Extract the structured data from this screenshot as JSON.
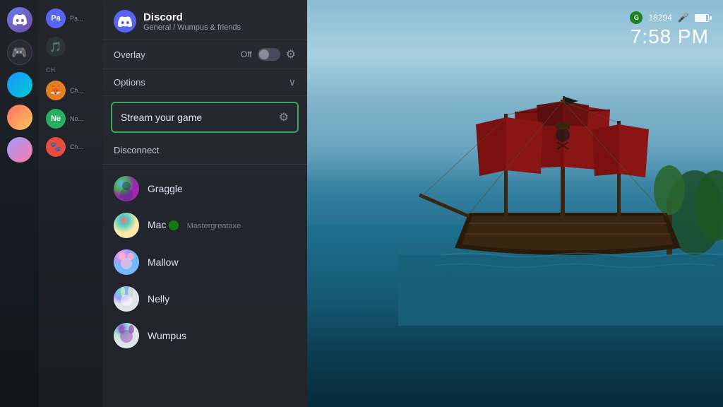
{
  "background": {
    "description": "Sea of Thieves pirate ship scene"
  },
  "hud": {
    "xbox_score": "18294",
    "time": "7:58 PM"
  },
  "sidebar_left": {
    "items": [
      {
        "id": "s1",
        "letter": "D",
        "color_class": "av-s1"
      },
      {
        "id": "s2",
        "letter": "",
        "color_class": "av-s2"
      },
      {
        "id": "s3",
        "letter": "",
        "color_class": "av-s3"
      },
      {
        "id": "s4",
        "letter": "",
        "color_class": "av-s4"
      },
      {
        "id": "s5",
        "letter": "",
        "color_class": "av-s5"
      }
    ]
  },
  "sidebar_mid": {
    "items": [
      {
        "label": "Pa...",
        "color": "#5865f2"
      },
      {
        "label": "",
        "color": "#2d3436"
      },
      {
        "label": "Ch...",
        "color": "#e67e22"
      },
      {
        "label": "Ne...",
        "color": "#27ae60"
      },
      {
        "label": "Ch...",
        "color": "#e74c3c"
      }
    ]
  },
  "discord": {
    "app_name": "Discord",
    "channel": "General / Wumpus & friends",
    "overlay": {
      "label": "Overlay",
      "toggle_state": "Off",
      "has_settings": true
    },
    "options": {
      "label": "Options",
      "expanded": true
    },
    "stream_game": {
      "label": "Stream your game",
      "has_settings": true
    },
    "disconnect": {
      "label": "Disconnect"
    },
    "users": [
      {
        "name": "Graggle",
        "color_class": "av-graggle",
        "game_tag": null,
        "xbox_tag": null
      },
      {
        "name": "Mac",
        "color_class": "av-mac",
        "game_tag": "Mastergreataxe",
        "xbox_tag": true
      },
      {
        "name": "Mallow",
        "color_class": "av-mallow",
        "game_tag": null,
        "xbox_tag": null
      },
      {
        "name": "Nelly",
        "color_class": "av-nelly",
        "game_tag": null,
        "xbox_tag": null
      },
      {
        "name": "Wumpus",
        "color_class": "av-wumpus",
        "game_tag": null,
        "xbox_tag": null
      }
    ]
  }
}
